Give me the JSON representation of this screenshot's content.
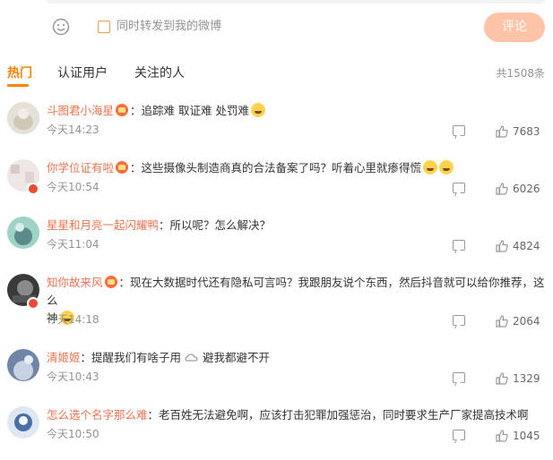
{
  "toolbar": {
    "repost_label": "同时转发到我的微博",
    "submit_label": "评论"
  },
  "tabs": {
    "items": [
      {
        "label": "热门"
      },
      {
        "label": "认证用户"
      },
      {
        "label": "关注的人"
      }
    ],
    "total": "共1508条"
  },
  "comments": [
    {
      "user": "斗图君小海星",
      "text": "：追踪难 取证难 处罚难",
      "time": "今天14:23",
      "likes": "7683"
    },
    {
      "user": "你学位证有啦",
      "text": "：这些摄像头制造商真的合法备案了吗？听着心里就瘆得慌",
      "time": "今天10:54",
      "likes": "6026"
    },
    {
      "user": "星星和月亮一起闪耀鸭",
      "text": "：所以呢？怎么解决？",
      "time": "今天11:04",
      "likes": "4824"
    },
    {
      "user": "知你故来风",
      "text": "：现在大数据时代还有隐私可言吗？我跟朋友说个东西，然后抖音就可以给你推荐，这么",
      "text2": "神",
      "time": "今天14:18",
      "likes": "2064"
    },
    {
      "user": "清姬姬",
      "text": "：提醒我们有啥子用",
      "text_b": "避我都避不开",
      "time": "今天10:43",
      "likes": "1329"
    },
    {
      "user": "怎么选个名字那么难",
      "text": "：老百姓无法避免啊，应该打击犯罪加强惩治，同时要求生产厂家提高技术啊",
      "time": "今天10:50",
      "likes": "1045"
    }
  ]
}
